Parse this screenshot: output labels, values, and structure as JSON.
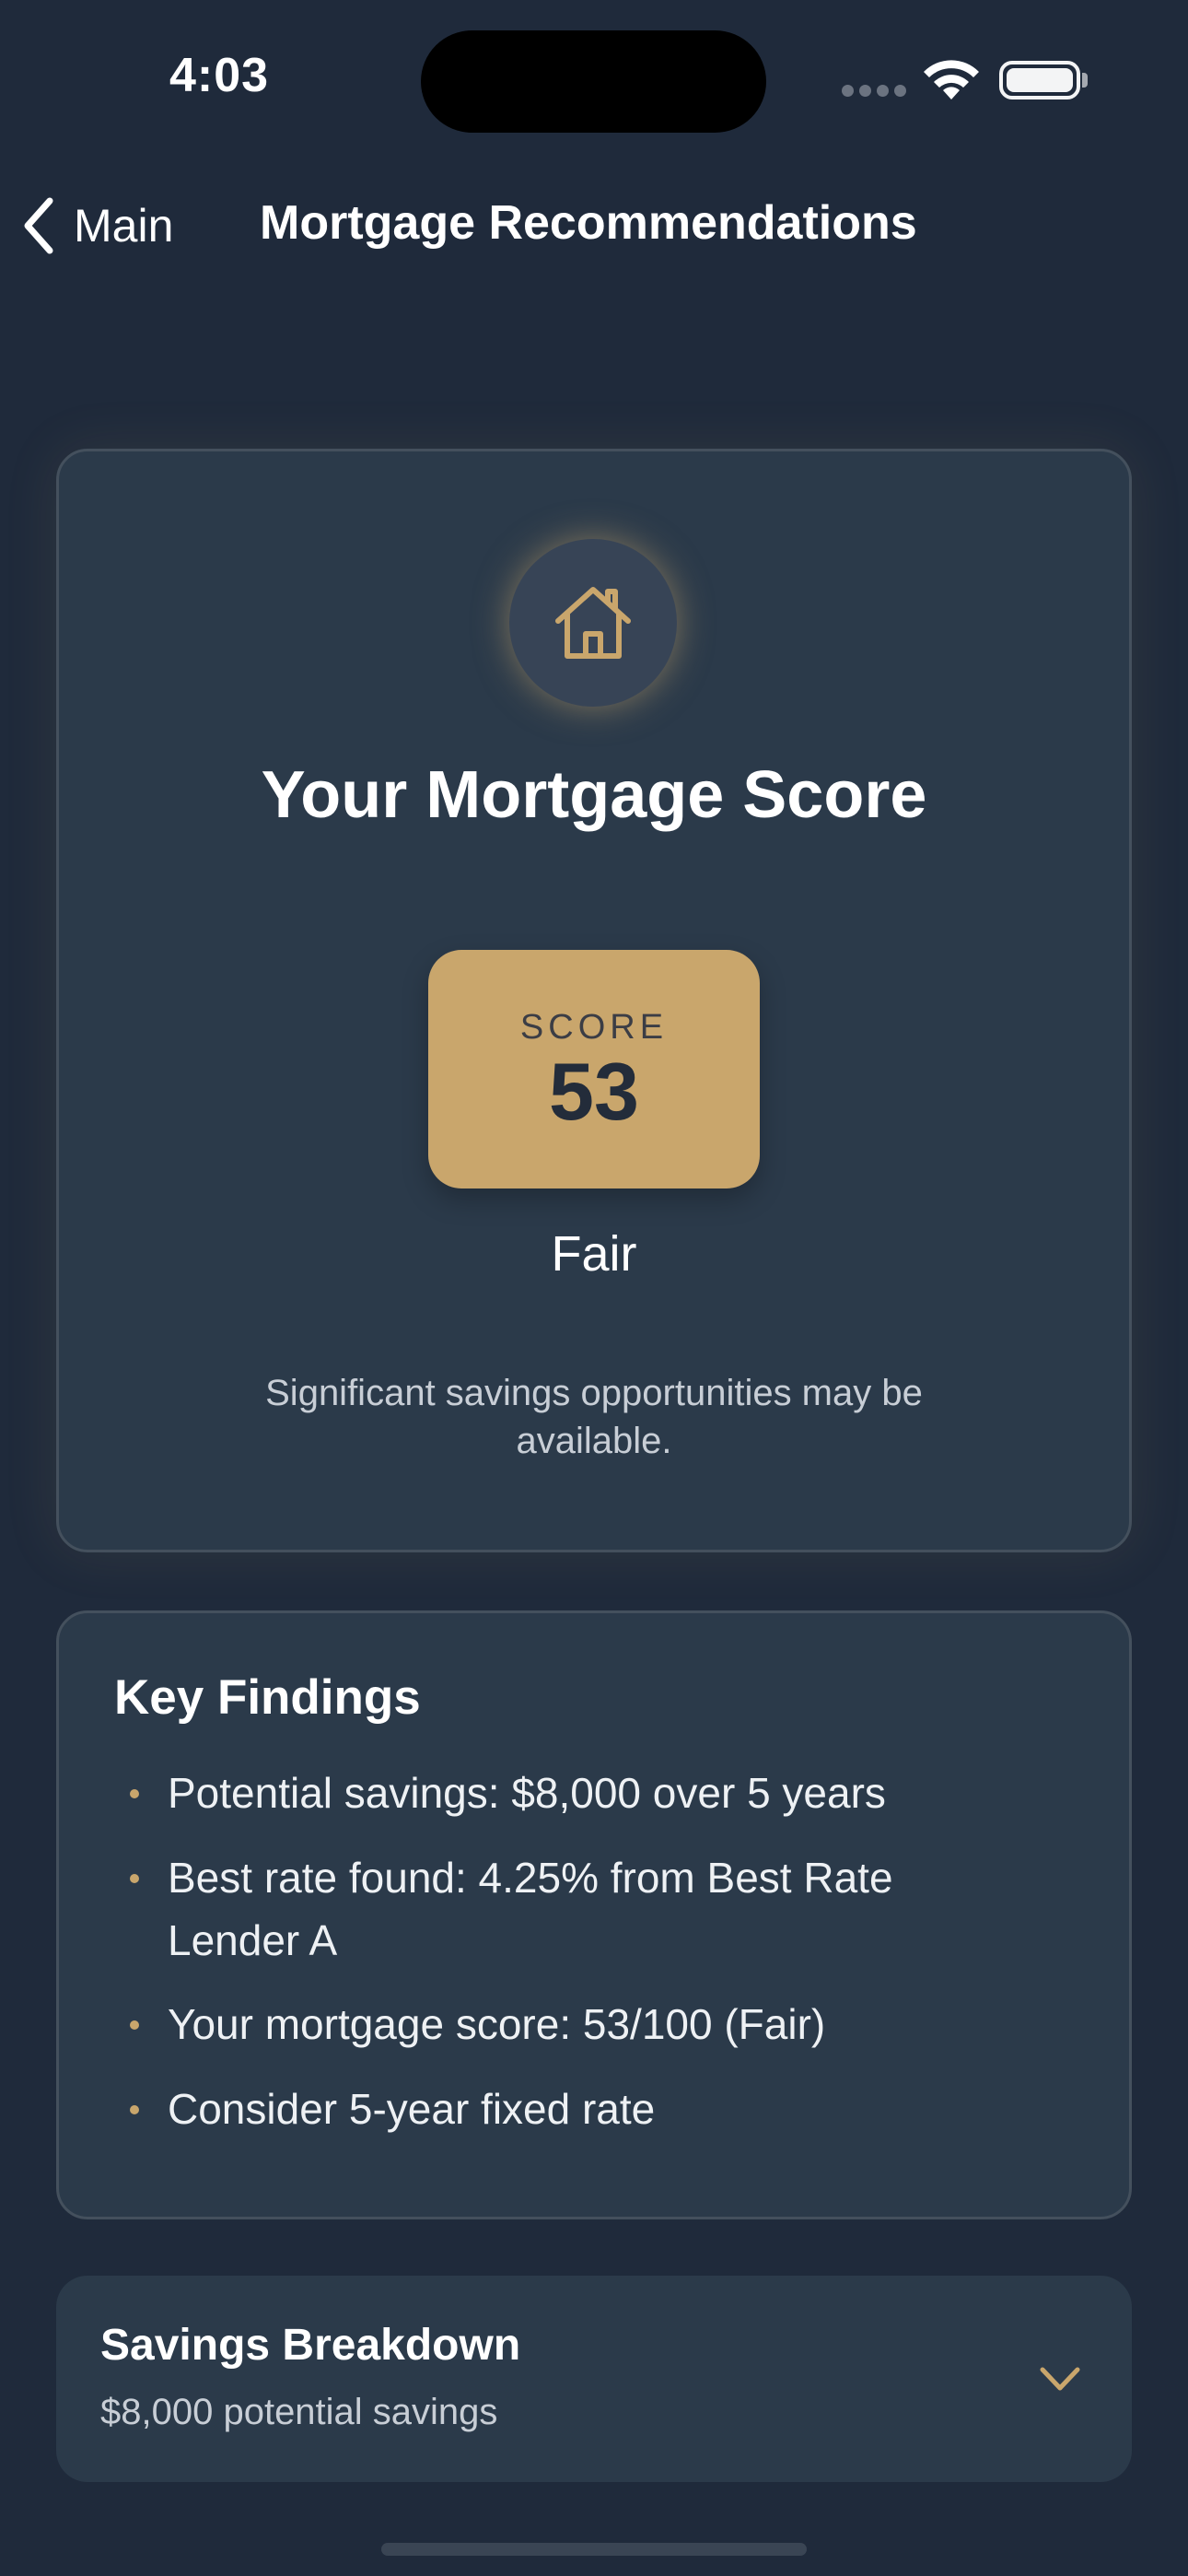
{
  "status_bar": {
    "time": "4:03"
  },
  "nav": {
    "back_label": "Main",
    "title": "Mortgage Recommendations"
  },
  "score_card": {
    "icon": "house-icon",
    "title": "Your Mortgage Score",
    "score_label": "SCORE",
    "score_value": "53",
    "rating": "Fair",
    "description": "Significant savings opportunities may be available."
  },
  "key_findings": {
    "title": "Key Findings",
    "items": [
      "Potential savings: $8,000 over 5 years",
      "Best rate found: 4.25% from Best Rate Lender A",
      "Your mortgage score: 53/100 (Fair)",
      "Consider 5-year fixed rate"
    ]
  },
  "savings_breakdown": {
    "title": "Savings Breakdown",
    "subtitle": "$8,000 potential savings",
    "icon": "chevron-down-icon"
  },
  "colors": {
    "background": "#1f2a3b",
    "card": "#2b3a4a",
    "accent_gold": "#c9a66c"
  }
}
